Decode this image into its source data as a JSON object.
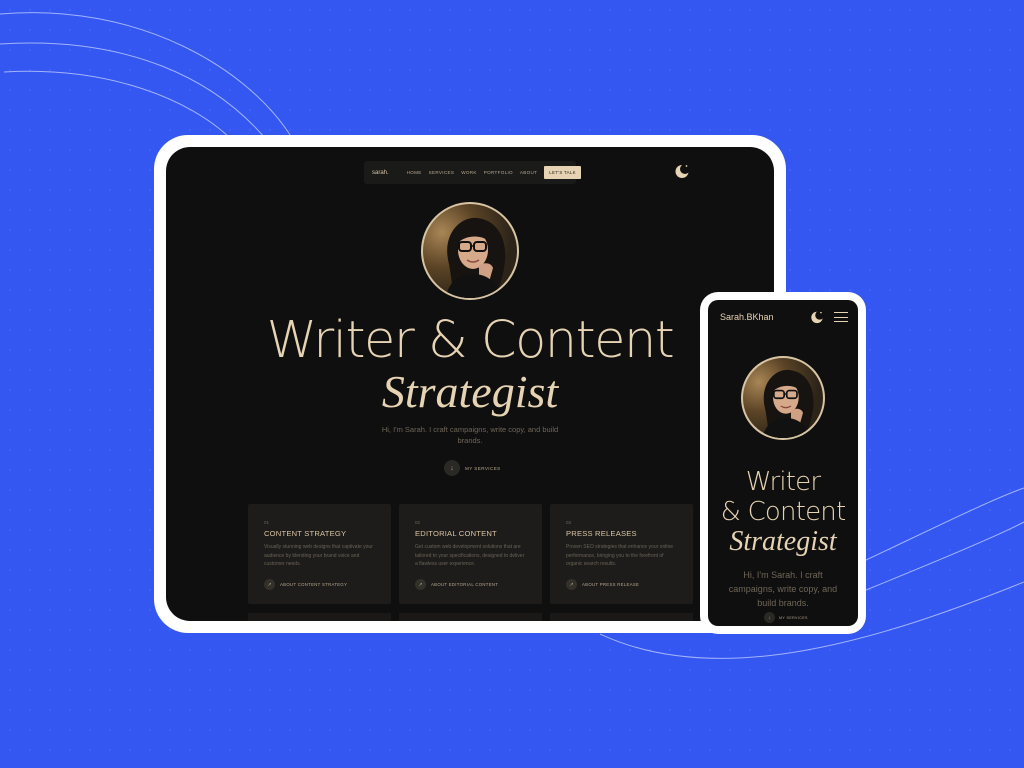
{
  "colors": {
    "background": "#3457f2",
    "device_frame": "#ffffff",
    "screen": "#0f0f0f",
    "accent": "#e6d3b3",
    "card": "#1d1c1a"
  },
  "tablet": {
    "nav": {
      "brand": "sarah.",
      "links": [
        "HOME",
        "SERVICES",
        "WORK",
        "PORTFOLIO",
        "ABOUT"
      ],
      "cta": "LET'S TALK"
    },
    "theme_icon": "moon-icon",
    "hero": {
      "line1": "Writer & Content",
      "line2": "Strategist",
      "subtitle": "Hi, I'm Sarah. I craft campaigns, write copy, and build brands.",
      "cta_label": "MY SERVICES",
      "cta_icon": "arrow-down-icon"
    },
    "cards": [
      {
        "num": "01",
        "title": "CONTENT STRATEGY",
        "desc": "Visually stunning web designs that captivate your audience by blending your brand voice and customer needs.",
        "link": "ABOUT CONTENT STRATEGY"
      },
      {
        "num": "02",
        "title": "EDITORIAL CONTENT",
        "desc": "Get custom web development solutions that are tailored to your specifications, designed to deliver a flawless user experience.",
        "link": "ABOUT EDITORIAL CONTENT"
      },
      {
        "num": "03",
        "title": "PRESS RELEASES",
        "desc": "Proven SEO strategies that enhance your online performance, bringing you to the forefront of organic search results.",
        "link": "ABOUT PRESS RELEASE"
      }
    ]
  },
  "phone": {
    "brand": "Sarah.BKhan",
    "theme_icon": "moon-icon",
    "menu_icon": "hamburger-menu-icon",
    "hero": {
      "line1": "Writer",
      "line2": "& Content",
      "line3": "Strategist",
      "subtitle": "Hi, I'm Sarah. I craft campaigns, write copy, and build brands.",
      "cta_label": "MY SERVICES"
    }
  }
}
